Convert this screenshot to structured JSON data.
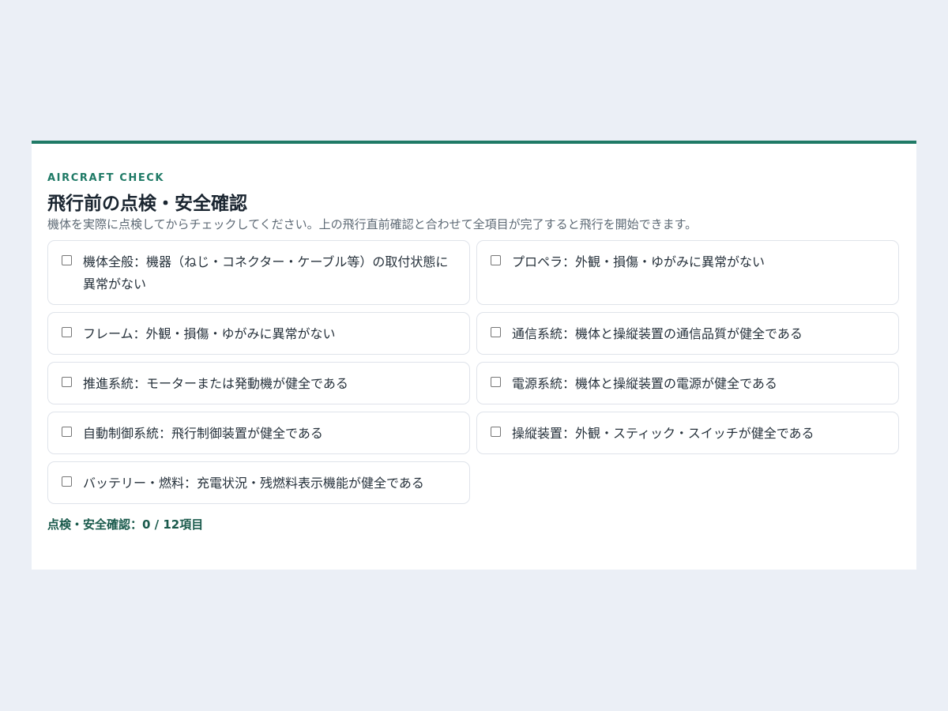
{
  "section": {
    "eyebrow": "AIRCRAFT CHECK",
    "title": "飛行前の点検・安全確認",
    "description": "機体を実際に点検してからチェックしてください。上の飛行直前確認と合わせて全項目が完了すると飛行を開始できます。"
  },
  "checklist": [
    {
      "label": "機体全般：機器（ねじ・コネクター・ケーブル等）の取付状態に異常がない",
      "checked": false
    },
    {
      "label": "プロペラ：外観・損傷・ゆがみに異常がない",
      "checked": false
    },
    {
      "label": "フレーム：外観・損傷・ゆがみに異常がない",
      "checked": false
    },
    {
      "label": "通信系統：機体と操縦装置の通信品質が健全である",
      "checked": false
    },
    {
      "label": "推進系統：モーターまたは発動機が健全である",
      "checked": false
    },
    {
      "label": "電源系統：機体と操縦装置の電源が健全である",
      "checked": false
    },
    {
      "label": "自動制御系統：飛行制御装置が健全である",
      "checked": false
    },
    {
      "label": "操縦装置：外観・スティック・スイッチが健全である",
      "checked": false
    },
    {
      "label": "バッテリー・燃料：充電状況・残燃料表示機能が健全である",
      "checked": false
    }
  ],
  "summary": {
    "text": "点検・安全確認：0 / 12項目"
  },
  "colors": {
    "accent": "#1f7a66",
    "background": "#ebeff6",
    "card": "#ffffff",
    "border": "#dfe3ea"
  }
}
